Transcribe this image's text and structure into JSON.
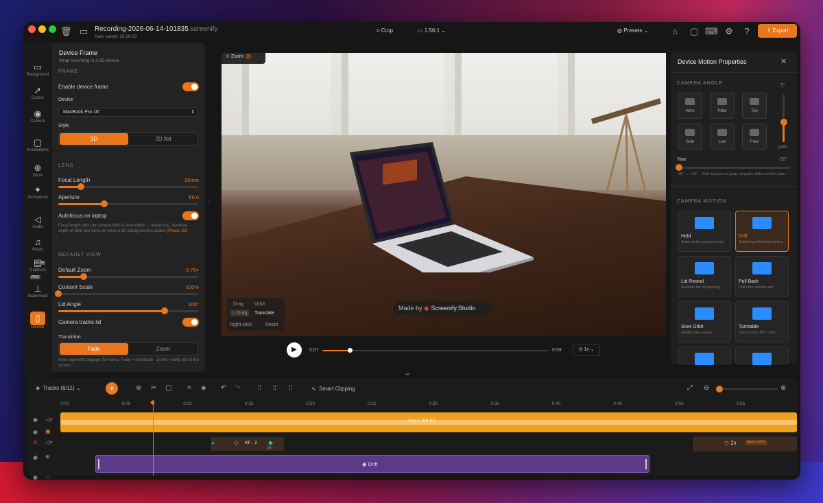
{
  "titlebar": {
    "filename": "Recording-2026-06-14-101835",
    "ext": ".screenify",
    "autosave": "Auto saved: 15:39:03",
    "crop": "Crop",
    "ratio": "1.56:1",
    "presets": "Presets",
    "export": "Export"
  },
  "rail": [
    {
      "label": "Background",
      "icon": "monitor-icon",
      "glyph": "▭"
    },
    {
      "label": "Cursor",
      "icon": "cursor-icon",
      "glyph": "➚"
    },
    {
      "label": "Camera",
      "icon": "camera-icon",
      "glyph": "◉"
    },
    {
      "label": "Annotations",
      "icon": "chat-icon",
      "glyph": "▢"
    },
    {
      "label": "Zoom",
      "icon": "zoom-icon",
      "glyph": "⊕"
    },
    {
      "label": "Animations",
      "icon": "sparkle-icon",
      "glyph": "✦"
    },
    {
      "label": "Audio",
      "icon": "speaker-icon",
      "glyph": "◁"
    },
    {
      "label": "Music",
      "icon": "music-icon",
      "glyph": "♫"
    },
    {
      "label": "Captions",
      "icon": "captions-icon",
      "glyph": "▤"
    },
    {
      "label": "Watermark",
      "icon": "stamp-icon",
      "glyph": "⊥"
    },
    {
      "label": "Device",
      "icon": "device-icon",
      "glyph": "▯"
    }
  ],
  "rail_badges": {
    "ai": "AI",
    "pro": "PRO"
  },
  "panel": {
    "title": "Device Frame",
    "subtitle": "Wrap recording in a 3D device",
    "frame_section": "FRAME",
    "enable_label": "Enable device frame",
    "device_label": "Device",
    "device_value": "MacBook Pro 16\"",
    "style_label": "Style",
    "style_options": [
      "3D",
      "2D flat"
    ],
    "lens_section": "LENS",
    "focal_label": "Focal Length",
    "focal_value": "50mm",
    "focal_pct": 0.16,
    "aperture_label": "Aperture",
    "aperture_value": "f/8.0",
    "aperture_pct": 0.33,
    "autofocus_label": "Autofocus on laptop",
    "lens_note_a": "Focal length sets the camera field of view (wide → telephoto).",
    "lens_note_b": "Aperture depth-of-field blur turns on once a 3D background is",
    "lens_note_c": "added",
    "lens_note_phase": "(Phase 1D)",
    "view_section": "DEFAULT VIEW",
    "zoom_label": "Default Zoom",
    "zoom_value": "0.75×",
    "zoom_pct": 0.18,
    "scale_label": "Content Scale",
    "scale_value": "100%",
    "scale_pct": 0.0,
    "lid_label": "Lid Angle",
    "lid_value": "100°",
    "lid_pct": 0.76,
    "tracks_lid_label": "Camera tracks lid",
    "transition_label": "Transition",
    "transition_options": [
      "Fade",
      "Zoom"
    ],
    "transition_note": "How segments engage the frame. Fade = crossfade · Zoom = dolly out of the screen."
  },
  "stage": {
    "zoom_chip": "Zoom",
    "zoom_count": "2",
    "drag": "Drag",
    "orbit": "Orbit",
    "drag2": "Drag",
    "translate": "Translate",
    "rightclick": "Right-click",
    "reset": "Reset",
    "madeby": "Made by",
    "brand": "Screenify.Studio"
  },
  "player": {
    "current": "0:07",
    "duration": "0:59",
    "speed": "1x",
    "progress": 0.12
  },
  "right": {
    "title": "Device Motion Properties",
    "camera_angle": "CAMERA ANGLE",
    "pitch_value": "5°",
    "pitch_label": "pitch",
    "pitch_pct": 0.42,
    "angles": [
      "Hero",
      "Pillar",
      "Top",
      "Side",
      "Low",
      "Free"
    ],
    "yaw_label": "Yaw",
    "yaw_value": "-52°",
    "yaw_pct": 0.02,
    "yaw_note": "-45° → +45° · Click a preset to jump, drag the sliders to fine-tune.",
    "camera_motion": "CAMERA MOTION",
    "motions": [
      {
        "t": "Hold",
        "d": "Static at the chosen angle"
      },
      {
        "t": "Drift",
        "d": "Subtle handheld breathing"
      },
      {
        "t": "Lid Reveal",
        "d": "Animate the lid opening"
      },
      {
        "t": "Pull Back",
        "d": "Dolly the camera out"
      },
      {
        "t": "Slow Orbit",
        "d": "Gentle yaw sweep"
      },
      {
        "t": "Turntable",
        "d": "Continuous 360° orbit"
      },
      {
        "t": "",
        "d": ""
      },
      {
        "t": "",
        "d": ""
      }
    ]
  },
  "timeline": {
    "tracks": "Tracks (6/11)",
    "smart": "Smart Clipping",
    "ticks": [
      "0:00",
      "0:05",
      "0:10",
      "0:15",
      "0:20",
      "0:25",
      "0:30",
      "0:35",
      "0:40",
      "0:45",
      "0:50",
      "0:55"
    ],
    "audio_clip": "Seg 1 (59.8s)",
    "kf": "KF · 2",
    "kf_mult": "2x",
    "zoom_mult": "2x",
    "dwell": "dwell 80%",
    "drift": "Drift"
  },
  "colors": {
    "accent": "#e8771e",
    "motion_purple": "#5b3a8a",
    "audio_orange": "#f0a020"
  }
}
